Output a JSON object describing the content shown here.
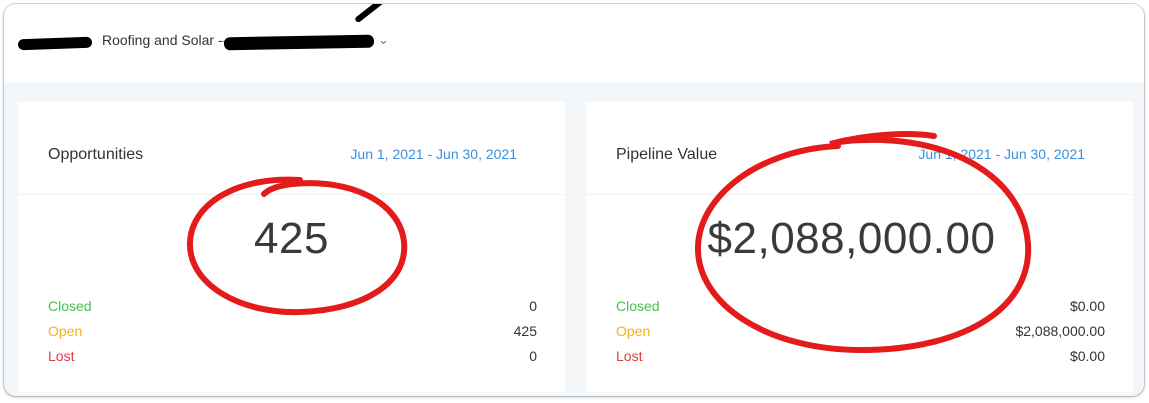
{
  "header": {
    "account_label": "Roofing and Solar --"
  },
  "cards": [
    {
      "title": "Opportunities",
      "date_range": "Jun 1, 2021 - Jun 30, 2021",
      "total": "425",
      "rows": [
        {
          "label": "Closed",
          "value": "0"
        },
        {
          "label": "Open",
          "value": "425"
        },
        {
          "label": "Lost",
          "value": "0"
        }
      ]
    },
    {
      "title": "Pipeline Value",
      "date_range": "Jun 1, 2021 - Jun 30, 2021",
      "total": "$2,088,000.00",
      "rows": [
        {
          "label": "Closed",
          "value": "$0.00"
        },
        {
          "label": "Open",
          "value": "$2,088,000.00"
        },
        {
          "label": "Lost",
          "value": "$0.00"
        }
      ]
    }
  ],
  "colors": {
    "closed": "#42c24a",
    "open": "#f0b21e",
    "lost": "#e03a44",
    "link": "#3b8fd9",
    "annotation": "#e41b1b"
  },
  "icons": {
    "account_dropdown": "chevron-down-icon"
  }
}
